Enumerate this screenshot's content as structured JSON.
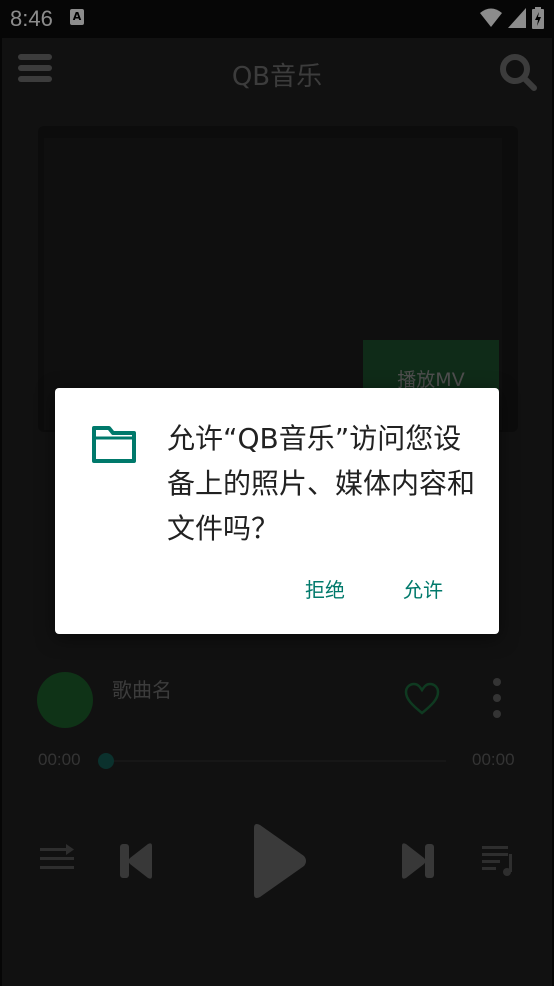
{
  "status_bar": {
    "time": "8:46",
    "notification_glyph": "A",
    "icons": [
      "wifi-icon",
      "signal-icon",
      "battery-charging-icon"
    ]
  },
  "app": {
    "title": "QB音乐",
    "menu_icon": "menu-icon",
    "search_icon": "search-icon",
    "play_mv_label": "播放MV",
    "song_name": "歌曲名",
    "favorite_icon": "heart-outline-icon",
    "more_icon": "more-vertical-icon",
    "progress": {
      "current_time": "00:00",
      "total_time": "00:00",
      "fraction": 0
    },
    "controls": [
      "play-mode-icon",
      "previous-icon",
      "play-icon",
      "next-icon",
      "playlist-icon"
    ]
  },
  "permission_dialog": {
    "icon": "folder-icon",
    "message": "允许“QB音乐”访问您设备上的照片、媒体内容和文件吗？",
    "deny_label": "拒绝",
    "allow_label": "允许"
  },
  "colors": {
    "accent_teal": "#00796b",
    "green_dark": "#1d5e2b",
    "background": "#1f1f1f"
  }
}
